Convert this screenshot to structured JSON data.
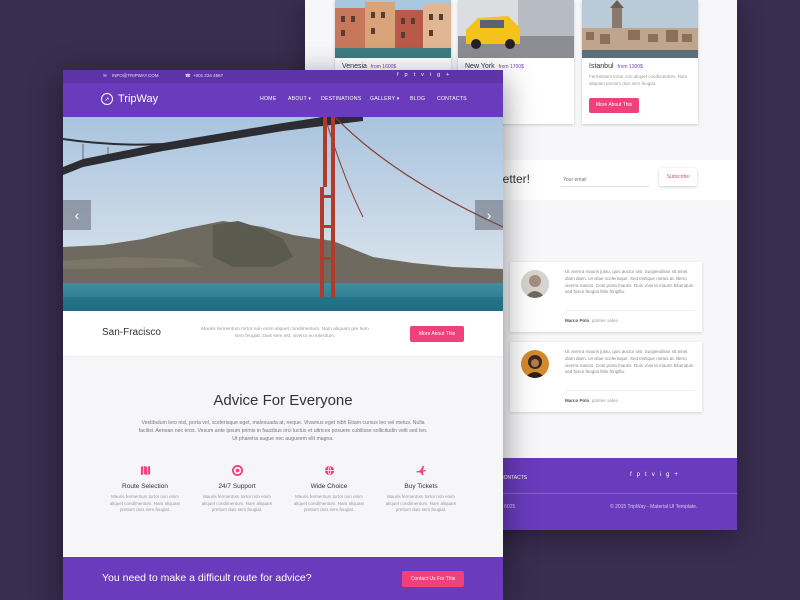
{
  "colors": {
    "brand_purple": "#6a3bbd",
    "accent_pink": "#f0417a",
    "background": "#3a2d50"
  },
  "back_page": {
    "destinations": [
      {
        "name": "Venesia",
        "price": "from 1600$",
        "text": "",
        "button": ""
      },
      {
        "name": "New York",
        "price": "from 1700$",
        "text": "",
        "button": ""
      },
      {
        "name": "Istanbul",
        "price": "from 1300$",
        "text": "Fermentum tortor non aliquet condimentum. Nam aliquam pretium duis sem feugiat.",
        "button": "More About This"
      }
    ],
    "newsletter": {
      "title": "letter!",
      "email_placeholder": "Your email",
      "subscribe": "Subscribe"
    },
    "testimonials": [
      {
        "text": "Ut viverra mauris justo, quis auctor nisi. Suspendisse sit amet diam diam. Ut vitae scelerisque. Sed tristique metus ac libero viverra mauris. Cras porta mauris. Duis viverra mauris bibendum sed fusce feugiat felis fringilla.",
        "author": "Marco Polo",
        "role": ", partner sales."
      },
      {
        "text": "Ut viverra mauris justo, quis auctor nisi. Suspendisse sit amet diam diam. Ut vitae scelerisque. Sed tristique metus ac libero viverra mauris. Cras porta mauris. Duis viverra mauris bibendum sed fusce feugiat felis fringilla.",
        "author": "Marco Polo",
        "role": ", partner sales."
      }
    ],
    "footer": {
      "link": "CONTACTS",
      "social": [
        "f",
        "p",
        "t",
        "v",
        "i",
        "g+"
      ],
      "number": "3 6025",
      "copyright": "© 2015 TripWay - Material UI Template."
    }
  },
  "topbar": {
    "email": "INFO@TRIPWAY.COM",
    "phone": "+001 234 4567",
    "social": [
      "f",
      "p",
      "t",
      "v",
      "i",
      "g+"
    ]
  },
  "nav": {
    "logo": "TripWay",
    "items": [
      "HOME",
      "ABOUT ▾",
      "DESTINATIONS",
      "GALLERY ▾",
      "BLOG",
      "CONTACTS"
    ]
  },
  "hero": {
    "prev": "‹",
    "next": "›"
  },
  "caption": {
    "city": "San-Fracisco",
    "text": "Mauris fermentum tortor non enim aliquet condimentum. Nam aliquam pre tium sem feugiat. Duis sem est, viverra eu interdum.",
    "button": "More About This"
  },
  "advice": {
    "title": "Advice For Everyone",
    "text": "Vestibulum lero nisl, porta vel, scelerisque eget, malesuada at, neque. Vivamus eget nibh Etiam cursus leo vel metus. Nulla facilisi. Aenean nec eros. Vesum ante ipsum primis in faucibus orci luctus et ultrices posuere cubilisse sollicitudin velit sed leo. Ut pharetra augue nec augueem elit magna.",
    "features": [
      {
        "icon": "map-icon",
        "name": "Route Selection",
        "text": "Mauris fermentum tortor non enim aliquet condimentum. Nam aliquam pretium duis sem feugiat."
      },
      {
        "icon": "lifebuoy-icon",
        "name": "24/7 Support",
        "text": "Mauris fermentum tortor non enim aliquet condimentum. Nam aliquam pretium duis sem feugiat."
      },
      {
        "icon": "globe-icon",
        "name": "Wide Choice",
        "text": "Mauris fermentum tortor non enim aliquet condimentum. Nam aliquam pretium duis sem feugiat."
      },
      {
        "icon": "plane-icon",
        "name": "Buy Tickets",
        "text": "Mauris fermentum tortor non enim aliquet condimentum. Nam aliquam pretium duis sem feugiat."
      }
    ]
  },
  "cta": {
    "text": "You need to make a difficult route for advice?",
    "button": "Contact Us For This"
  }
}
